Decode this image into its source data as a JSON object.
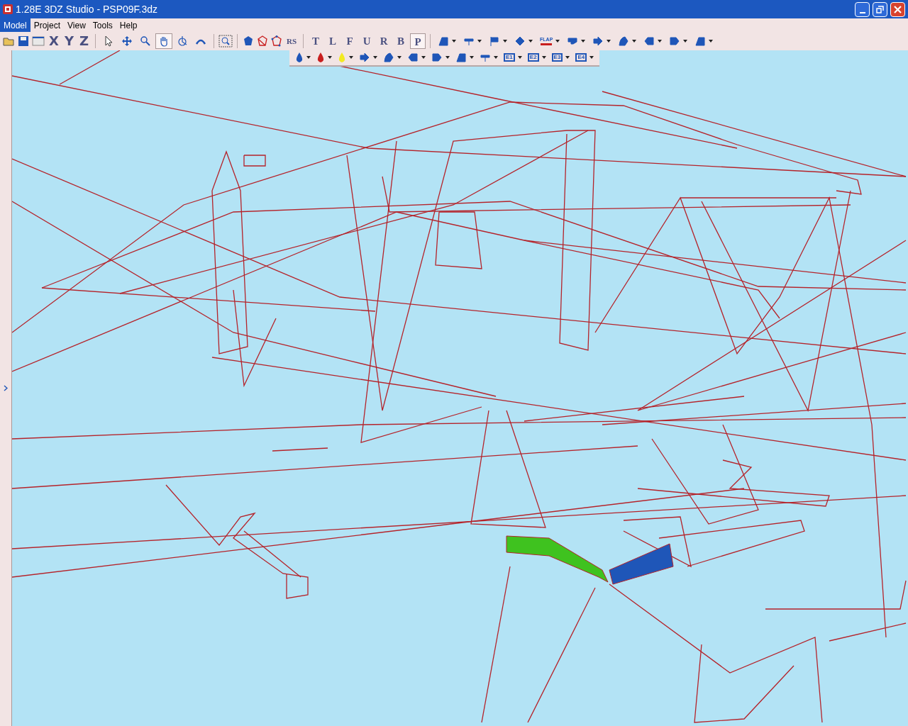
{
  "window": {
    "title": "1.28E 3DZ Studio - PSP09F.3dz"
  },
  "menu": [
    {
      "label": "Model",
      "selected": true
    },
    {
      "label": "Project",
      "selected": false
    },
    {
      "label": "View",
      "selected": false
    },
    {
      "label": "Tools",
      "selected": false
    },
    {
      "label": "Help",
      "selected": false
    }
  ],
  "toolbar": {
    "axis_buttons": [
      {
        "label": "X"
      },
      {
        "label": "Y"
      },
      {
        "label": "Z"
      }
    ],
    "nav_tools": [
      {
        "selected": false
      },
      {
        "selected": false
      },
      {
        "selected": false
      },
      {
        "selected": true
      },
      {
        "selected": false
      },
      {
        "selected": false
      }
    ],
    "rs_button": {
      "label": "RS"
    },
    "view_buttons": [
      {
        "label": "T",
        "selected": false
      },
      {
        "label": "L",
        "selected": false
      },
      {
        "label": "F",
        "selected": false
      },
      {
        "label": "U",
        "selected": false
      },
      {
        "label": "R",
        "selected": false
      },
      {
        "label": "B",
        "selected": false
      },
      {
        "label": "P",
        "selected": true
      }
    ],
    "part_row_1": [
      {
        "kind": "icon"
      },
      {
        "kind": "icon"
      },
      {
        "kind": "icon"
      },
      {
        "kind": "icon"
      },
      {
        "kind": "labelled",
        "label": "FLAP"
      },
      {
        "kind": "icon"
      },
      {
        "kind": "icon"
      },
      {
        "kind": "icon"
      },
      {
        "kind": "icon"
      },
      {
        "kind": "icon"
      },
      {
        "kind": "icon"
      }
    ],
    "part_row_2": [
      {
        "kind": "icon"
      },
      {
        "kind": "icon"
      },
      {
        "kind": "icon"
      },
      {
        "kind": "icon"
      },
      {
        "kind": "icon"
      },
      {
        "kind": "icon"
      },
      {
        "kind": "icon"
      },
      {
        "kind": "icon"
      },
      {
        "kind": "icon"
      },
      {
        "kind": "labelled",
        "label": "E1"
      },
      {
        "kind": "labelled",
        "label": "E2"
      },
      {
        "kind": "labelled",
        "label": "E3"
      },
      {
        "kind": "labelled",
        "label": "E4"
      }
    ]
  }
}
